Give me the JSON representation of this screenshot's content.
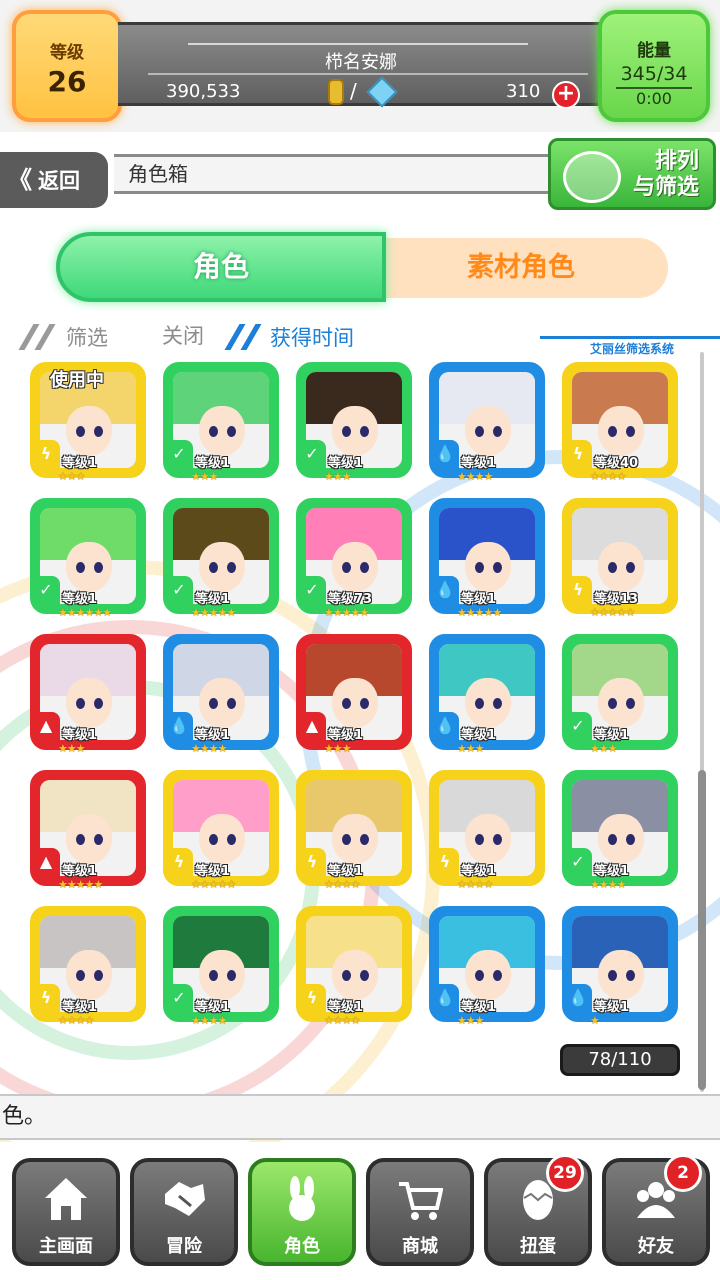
{
  "header": {
    "level_label": "等级",
    "level_value": "26",
    "player_name": "栉名安娜",
    "money": "390,533",
    "slash": "/",
    "gems": "310",
    "plus": "+",
    "energy_label": "能量",
    "energy_value": "345/34",
    "energy_timer": "0:00"
  },
  "nav": {
    "back_label": "返回",
    "back_chevron": "《",
    "title": "角色箱",
    "sort_label_line1": "排列",
    "sort_label_line2": "与筛选"
  },
  "tabs": {
    "characters": "角色",
    "materials": "素材角色"
  },
  "filter": {
    "label": "筛选",
    "state": "关闭",
    "sort": "获得时间",
    "system": "艾丽丝筛选系统"
  },
  "colors": {
    "yellow": "#f7d21b",
    "green": "#31d160",
    "blue": "#1f8de3",
    "red": "#e3262b"
  },
  "cards": [
    {
      "frame": "yellow",
      "element": "thunder",
      "level": "等级1",
      "stars": "★★★",
      "in_use": "使用中"
    },
    {
      "frame": "green",
      "element": "wind",
      "level": "等级1",
      "stars": "★★★",
      "in_use": ""
    },
    {
      "frame": "green",
      "element": "wind",
      "level": "等级1",
      "stars": "★★★",
      "in_use": ""
    },
    {
      "frame": "blue",
      "element": "water",
      "level": "等级1",
      "stars": "★★★★",
      "in_use": ""
    },
    {
      "frame": "yellow",
      "element": "thunder",
      "level": "等级40",
      "stars": "★★★★",
      "in_use": ""
    },
    {
      "frame": "green",
      "element": "wind",
      "level": "等级1",
      "stars": "★★★★★★",
      "in_use": ""
    },
    {
      "frame": "green",
      "element": "wind",
      "level": "等级1",
      "stars": "★★★★★",
      "in_use": ""
    },
    {
      "frame": "green",
      "element": "wind",
      "level": "等级73",
      "stars": "★★★★★",
      "in_use": ""
    },
    {
      "frame": "blue",
      "element": "water",
      "level": "等级1",
      "stars": "★★★★★",
      "in_use": ""
    },
    {
      "frame": "yellow",
      "element": "thunder",
      "level": "等级13",
      "stars": "★★★★★",
      "in_use": ""
    },
    {
      "frame": "red",
      "element": "fire",
      "level": "等级1",
      "stars": "★★★",
      "in_use": ""
    },
    {
      "frame": "blue",
      "element": "water",
      "level": "等级1",
      "stars": "★★★★",
      "in_use": ""
    },
    {
      "frame": "red",
      "element": "fire",
      "level": "等级1",
      "stars": "★★★",
      "in_use": ""
    },
    {
      "frame": "blue",
      "element": "water",
      "level": "等级1",
      "stars": "★★★",
      "in_use": ""
    },
    {
      "frame": "green",
      "element": "wind",
      "level": "等级1",
      "stars": "★★★",
      "in_use": ""
    },
    {
      "frame": "red",
      "element": "fire",
      "level": "等级1",
      "stars": "★★★★★",
      "in_use": ""
    },
    {
      "frame": "yellow",
      "element": "thunder",
      "level": "等级1",
      "stars": "★★★★★",
      "in_use": ""
    },
    {
      "frame": "yellow",
      "element": "thunder",
      "level": "等级1",
      "stars": "★★★★",
      "in_use": ""
    },
    {
      "frame": "yellow",
      "element": "thunder",
      "level": "等级1",
      "stars": "★★★★",
      "in_use": ""
    },
    {
      "frame": "green",
      "element": "wind",
      "level": "等级1",
      "stars": "★★★★",
      "in_use": ""
    },
    {
      "frame": "yellow",
      "element": "thunder",
      "level": "等级1",
      "stars": "★★★★",
      "in_use": ""
    },
    {
      "frame": "green",
      "element": "wind",
      "level": "等级1",
      "stars": "★★★★",
      "in_use": ""
    },
    {
      "frame": "yellow",
      "element": "thunder",
      "level": "等级1",
      "stars": "★★★★",
      "in_use": ""
    },
    {
      "frame": "blue",
      "element": "water",
      "level": "等级1",
      "stars": "★★★",
      "in_use": ""
    },
    {
      "frame": "blue",
      "element": "water",
      "level": "等级1",
      "stars": "★",
      "in_use": ""
    }
  ],
  "box_count": "78/110",
  "message": "色。",
  "bottom_nav": {
    "home": "主画面",
    "adventure": "冒险",
    "characters": "角色",
    "shop": "商城",
    "gacha": "扭蛋",
    "gacha_badge": "29",
    "friends": "好友",
    "friends_badge": "2"
  }
}
